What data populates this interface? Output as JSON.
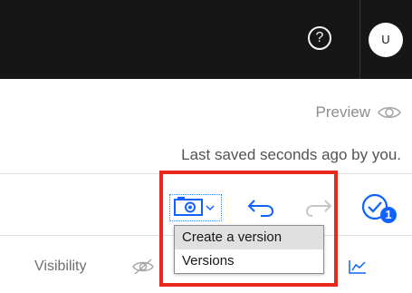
{
  "header": {
    "help_glyph": "?",
    "avatar_initial": "U"
  },
  "status": {
    "preview_label": "Preview",
    "last_saved": "Last saved seconds ago by you."
  },
  "toolbar": {
    "notification_count": "1",
    "accent_color": "#0f62fe"
  },
  "properties": {
    "visibility_label": "Visibility"
  },
  "version_menu": {
    "items": [
      {
        "label": "Create a version"
      },
      {
        "label": "Versions"
      }
    ]
  },
  "annotation": {
    "highlight_color": "#e8291c"
  }
}
